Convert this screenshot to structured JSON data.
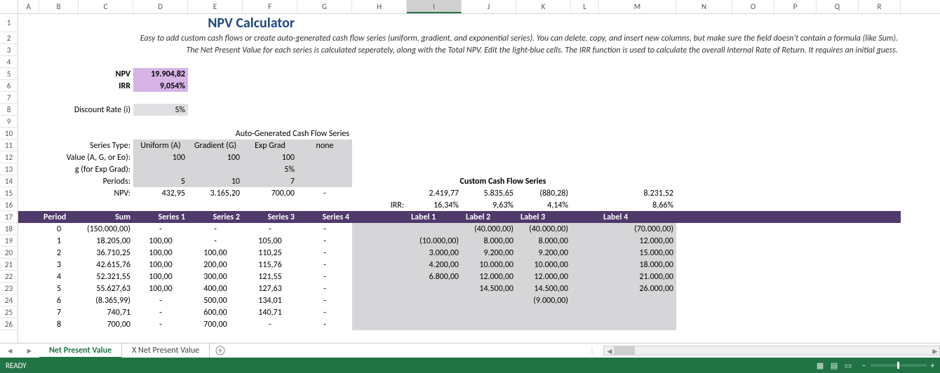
{
  "columns": [
    {
      "l": "A",
      "w": 30
    },
    {
      "l": "B",
      "w": 56
    },
    {
      "l": "C",
      "w": 78
    },
    {
      "l": "D",
      "w": 78
    },
    {
      "l": "E",
      "w": 78
    },
    {
      "l": "F",
      "w": 78
    },
    {
      "l": "G",
      "w": 78
    },
    {
      "l": "H",
      "w": 78
    },
    {
      "l": "I",
      "w": 78
    },
    {
      "l": "J",
      "w": 78
    },
    {
      "l": "K",
      "w": 78
    },
    {
      "l": "L",
      "w": 40
    },
    {
      "l": "M",
      "w": 110
    },
    {
      "l": "N",
      "w": 80
    },
    {
      "l": "O",
      "w": 60
    },
    {
      "l": "P",
      "w": 60
    },
    {
      "l": "Q",
      "w": 60
    },
    {
      "l": "R",
      "w": 60
    }
  ],
  "active_col": "I",
  "rows": [
    "1",
    "2",
    "3",
    "4",
    "5",
    "6",
    "7",
    "8",
    "9",
    "10",
    "11",
    "12",
    "13",
    "14",
    "15",
    "16",
    "17",
    "18",
    "19",
    "20",
    "21",
    "22",
    "23",
    "24",
    "25",
    "26"
  ],
  "title": "NPV Calculator",
  "desc1": "Easy to add custom cash flows or create auto-generated cash flow series (uniform, gradient, and exponential series). You can delete, copy, and insert new columns, but make sure the field doesn't contain a formula (like Sum).",
  "desc2": "The Net Present Value for each series is calculated seperately, along with the Total NPV. Edit the light-blue cells. The IRR function is used to calculate the overall Internal Rate of Return. It requires an initial guess.",
  "npv_label": "NPV",
  "npv_val": "19.904,82",
  "irr_label": "IRR",
  "irr_val": "9,054%",
  "disc_label": "Discount Rate (i)",
  "disc_val": "5%",
  "auto_heading": "Auto-Generated Cash Flow Series",
  "series_type_label": "Series Type:",
  "series_types": [
    "Uniform (A)",
    "Gradient (G)",
    "Exp Grad",
    "none"
  ],
  "value_label": "Value (A, G, or Eo):",
  "value_vals": [
    "100",
    "100",
    "100",
    ""
  ],
  "g_label": "g (for Exp Grad):",
  "g_vals": [
    "",
    "",
    "5%",
    ""
  ],
  "periods_label": "Periods:",
  "periods_vals": [
    "5",
    "10",
    "7",
    ""
  ],
  "series_npv_label": "NPV:",
  "series_npv_vals": [
    "432,95",
    "3.165,20",
    "700,00",
    "-"
  ],
  "custom_heading": "Custom Cash Flow Series",
  "custom_npv": [
    "2.419,77",
    "5.835,65",
    "(880,28)",
    "8.231,52"
  ],
  "irr_row_label": "IRR:",
  "custom_irr": [
    "16,34%",
    "9,63%",
    "4,14%",
    "8,66%"
  ],
  "table_hdr": [
    "Period",
    "Sum",
    "Series 1",
    "Series 2",
    "Series 3",
    "Series 4"
  ],
  "custom_hdr": [
    "Label 1",
    "Label 2",
    "Label 3",
    "Label 4"
  ],
  "data_rows": [
    {
      "p": "0",
      "sum": "(150.000,00)",
      "s": [
        "-",
        "-",
        "-",
        "-"
      ],
      "c": [
        "",
        "(40.000,00)",
        "(40.000,00)",
        "(70.000,00)"
      ]
    },
    {
      "p": "1",
      "sum": "18.205,00",
      "s": [
        "100,00",
        "-",
        "105,00",
        "-"
      ],
      "c": [
        "(10.000,00)",
        "8.000,00",
        "8.000,00",
        "12.000,00"
      ]
    },
    {
      "p": "2",
      "sum": "36.710,25",
      "s": [
        "100,00",
        "100,00",
        "110,25",
        "-"
      ],
      "c": [
        "3.000,00",
        "9.200,00",
        "9.200,00",
        "15.000,00"
      ]
    },
    {
      "p": "3",
      "sum": "42.615,76",
      "s": [
        "100,00",
        "200,00",
        "115,76",
        "-"
      ],
      "c": [
        "4.200,00",
        "10.000,00",
        "10.000,00",
        "18.000,00"
      ]
    },
    {
      "p": "4",
      "sum": "52.321,55",
      "s": [
        "100,00",
        "300,00",
        "121,55",
        "-"
      ],
      "c": [
        "6.800,00",
        "12.000,00",
        "12.000,00",
        "21.000,00"
      ]
    },
    {
      "p": "5",
      "sum": "55.627,63",
      "s": [
        "100,00",
        "400,00",
        "127,63",
        "-"
      ],
      "c": [
        "",
        "14.500,00",
        "14.500,00",
        "26.000,00"
      ]
    },
    {
      "p": "6",
      "sum": "(8.365,99)",
      "s": [
        "-",
        "500,00",
        "134,01",
        "-"
      ],
      "c": [
        "",
        "",
        "(9.000,00)",
        ""
      ]
    },
    {
      "p": "7",
      "sum": "740,71",
      "s": [
        "-",
        "600,00",
        "140,71",
        "-"
      ],
      "c": [
        "",
        "",
        "",
        ""
      ]
    },
    {
      "p": "8",
      "sum": "700,00",
      "s": [
        "-",
        "700,00",
        "-",
        "-"
      ],
      "c": [
        "",
        "",
        "",
        ""
      ]
    }
  ],
  "tabs": {
    "active": "Net Present Value",
    "other": "X Net Present Value"
  },
  "status": "READY"
}
